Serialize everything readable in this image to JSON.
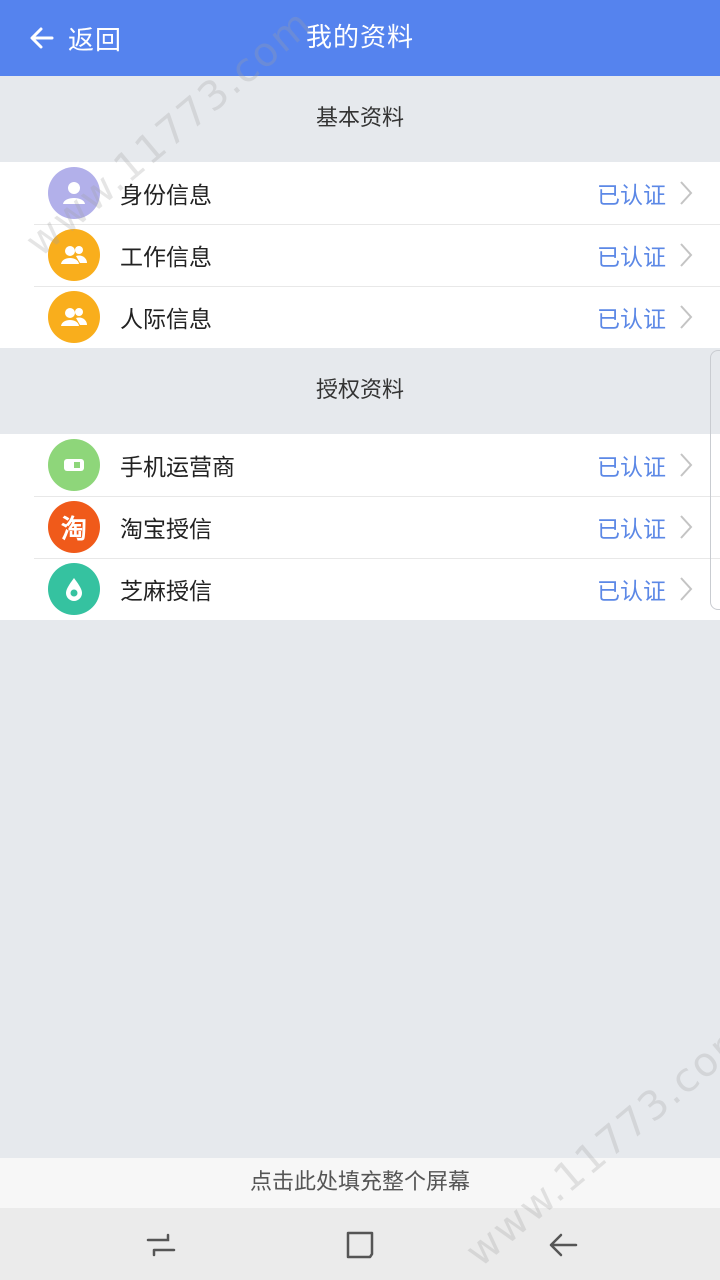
{
  "header": {
    "back_label": "返回",
    "title": "我的资料",
    "background": "#5583ee"
  },
  "sections": [
    {
      "title": "基本资料",
      "items": [
        {
          "label": "身份信息",
          "status": "已认证",
          "icon": "identity-icon",
          "icon_color": "#b2b0ea"
        },
        {
          "label": "工作信息",
          "status": "已认证",
          "icon": "people-icon",
          "icon_color": "#f9ae1c"
        },
        {
          "label": "人际信息",
          "status": "已认证",
          "icon": "people-icon",
          "icon_color": "#f9ae1c"
        }
      ]
    },
    {
      "title": "授权资料",
      "items": [
        {
          "label": "手机运营商",
          "status": "已认证",
          "icon": "sim-card-icon",
          "icon_color": "#8ed67a"
        },
        {
          "label": "淘宝授信",
          "status": "已认证",
          "icon": "taobao-icon",
          "icon_color": "#f05a1a",
          "icon_text": "淘"
        },
        {
          "label": "芝麻授信",
          "status": "已认证",
          "icon": "sesame-icon",
          "icon_color": "#35c2a0"
        }
      ]
    }
  ],
  "status_color": "#5c88e6",
  "fill_screen_label": "点击此处填充整个屏幕",
  "nav": {
    "recent": "recent-apps-icon",
    "home": "home-icon",
    "back": "nav-back-icon"
  },
  "watermark": "www.11773.com"
}
